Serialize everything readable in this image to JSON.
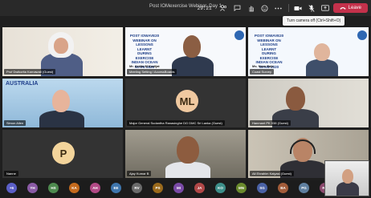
{
  "window": {
    "title": "Post IOMexercise Webinar, Day 1"
  },
  "toolbar": {
    "timer": "29:21",
    "leave_label": "Leave"
  },
  "tooltip": {
    "text": "Turn camera off (Ctrl+Shift+O)"
  },
  "banner": {
    "title_lines": [
      "POST IOWAVE20",
      "WEBINAR ON",
      "LESSONS LEARNT",
      "DURING EXERCISE",
      "INDIAN OCEAN",
      "WAVE 2020"
    ],
    "australia": "AUSTRALIA"
  },
  "tiles": [
    {
      "name": "Prof Dwikorita Karnawati (Guest)",
      "type": "video"
    },
    {
      "name": "Mr. Ardito M Kodijat",
      "subtitle": "Meeting Setting / AccessBoards",
      "type": "video"
    },
    {
      "name": "Ms. Nora Gale",
      "subtitle": "Coast Survey",
      "type": "video"
    },
    {
      "name": "Simon Allen",
      "type": "video"
    },
    {
      "name": "Major General Sudantha Ranasinghe DG DMC Sri Lanka (Guest)",
      "type": "avatar",
      "initials": "ML"
    },
    {
      "name": "Hanmant PK 038 (Guest)",
      "type": "video"
    },
    {
      "name": "Nanne",
      "type": "avatar",
      "initials": "P"
    },
    {
      "name": "Ajay Kumar B",
      "type": "video"
    },
    {
      "name": "Ali Ebrahim Kaiyasi (Guest)",
      "type": "video"
    }
  ],
  "roster": [
    {
      "initials": "+6",
      "color": "#5b5fc7"
    },
    {
      "initials": "YH",
      "color": "#8a5aa5"
    },
    {
      "initials": "HS",
      "color": "#4e8a4f"
    },
    {
      "initials": "KA",
      "color": "#c46a1d"
    },
    {
      "initials": "AH",
      "color": "#b24a86"
    },
    {
      "initials": "EE",
      "color": "#3f76ad"
    },
    {
      "initials": "RV",
      "color": "#6b6b6b"
    },
    {
      "initials": "PS",
      "color": "#9a6a1c"
    },
    {
      "initials": "MI",
      "color": "#7a4aa6"
    },
    {
      "initials": "JA",
      "color": "#b04747"
    },
    {
      "initials": "KO",
      "color": "#3d8f8a"
    },
    {
      "initials": "MN",
      "color": "#6a8a2d"
    },
    {
      "initials": "SG",
      "color": "#4a62a6"
    },
    {
      "initials": "BA",
      "color": "#a25c3a"
    },
    {
      "initials": "PG",
      "color": "#5f7f9f"
    },
    {
      "initials": "RH",
      "color": "#8d4a6f"
    }
  ],
  "colors": {
    "leave": "#c4314b",
    "avatar_ml": "#f0c9a0",
    "avatar_p": "#f3d49b",
    "background": "#1f1f1f"
  },
  "icons": [
    "people-icon",
    "chat-icon",
    "raise-hand-icon",
    "reactions-icon",
    "more-icon",
    "camera-icon",
    "mic-icon",
    "share-icon",
    "phone-icon"
  ]
}
